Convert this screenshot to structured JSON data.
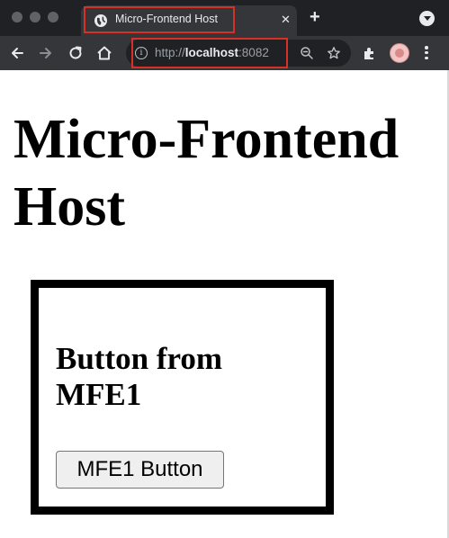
{
  "browser": {
    "tab": {
      "title": "Micro-Frontend Host",
      "close_glyph": "✕",
      "favicon": "globe-icon"
    },
    "new_tab_glyph": "+",
    "address_bar": {
      "scheme": "http://",
      "host": "localhost",
      "port": ":8082"
    },
    "icons": [
      "back-arrow-icon",
      "forward-arrow-icon",
      "reload-icon",
      "home-icon",
      "info-icon",
      "zoom-icon",
      "star-icon",
      "extensions-icon",
      "avatar",
      "kebab-menu-icon"
    ],
    "highlight_color": "#d93025"
  },
  "page": {
    "title": "Micro-Frontend Host",
    "mfe1": {
      "heading": "Button from MFE1",
      "button_label": "MFE1 Button"
    }
  }
}
